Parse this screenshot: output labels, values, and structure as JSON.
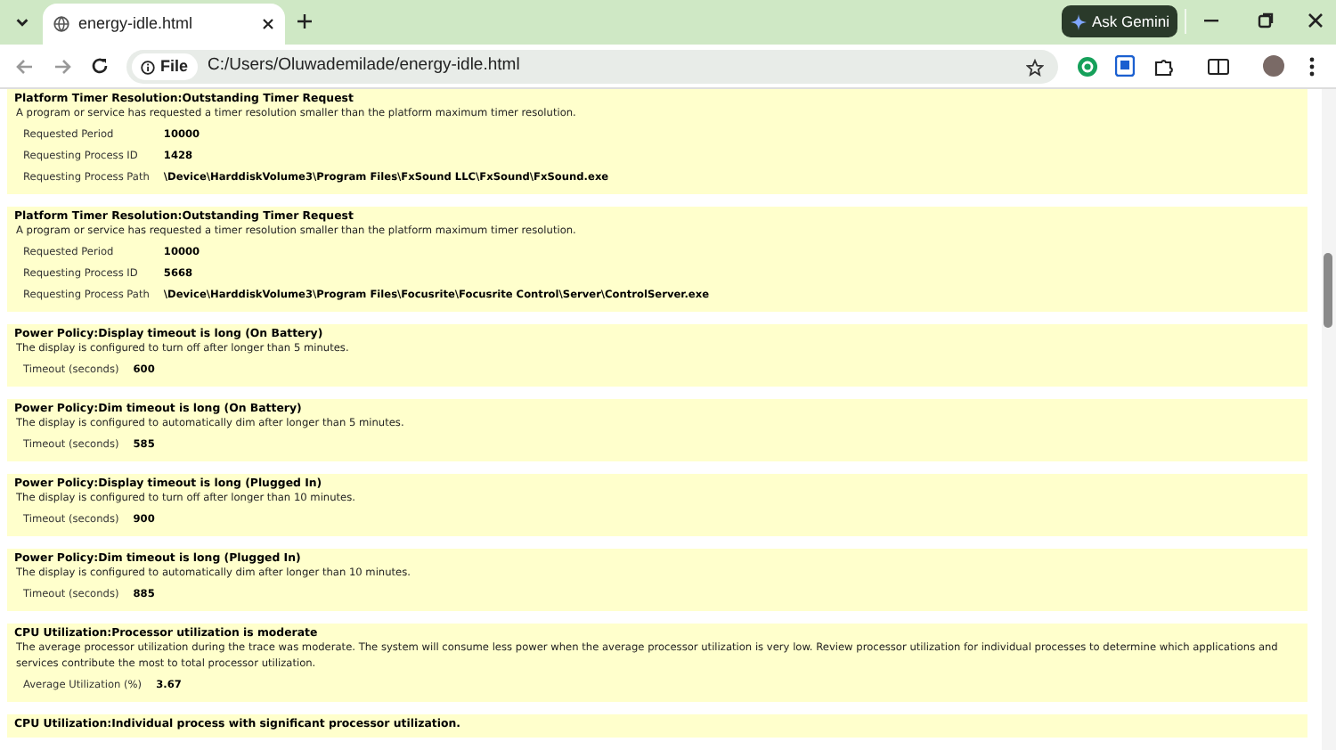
{
  "browser": {
    "tab": {
      "title": "energy-idle.html",
      "selected": true
    },
    "ask_button": "Ask Gemini",
    "address": {
      "scheme_chip": "File",
      "url": "C:/Users/Oluwademilade/energy-idle.html"
    }
  },
  "sections": [
    {
      "title": "Platform Timer Resolution:Outstanding Timer Request",
      "description": "A program or service has requested a timer resolution smaller than the platform maximum timer resolution.",
      "rows": [
        {
          "label": "Requested Period",
          "value": "10000"
        },
        {
          "label": "Requesting Process ID",
          "value": "1428"
        },
        {
          "label": "Requesting Process Path",
          "value": "\\Device\\HarddiskVolume3\\Program Files\\FxSound LLC\\FxSound\\FxSound.exe"
        }
      ]
    },
    {
      "title": "Platform Timer Resolution:Outstanding Timer Request",
      "description": "A program or service has requested a timer resolution smaller than the platform maximum timer resolution.",
      "rows": [
        {
          "label": "Requested Period",
          "value": "10000"
        },
        {
          "label": "Requesting Process ID",
          "value": "5668"
        },
        {
          "label": "Requesting Process Path",
          "value": "\\Device\\HarddiskVolume3\\Program Files\\Focusrite\\Focusrite Control\\Server\\ControlServer.exe"
        }
      ]
    },
    {
      "title": "Power Policy:Display timeout is long (On Battery)",
      "description": "The display is configured to turn off after longer than 5 minutes.",
      "rows": [
        {
          "label": "Timeout (seconds)",
          "value": "600"
        }
      ]
    },
    {
      "title": "Power Policy:Dim timeout is long (On Battery)",
      "description": "The display is configured to automatically dim after longer than 5 minutes.",
      "rows": [
        {
          "label": "Timeout (seconds)",
          "value": "585"
        }
      ]
    },
    {
      "title": "Power Policy:Display timeout is long (Plugged In)",
      "description": "The display is configured to turn off after longer than 10 minutes.",
      "rows": [
        {
          "label": "Timeout (seconds)",
          "value": "900"
        }
      ]
    },
    {
      "title": "Power Policy:Dim timeout is long (Plugged In)",
      "description": "The display is configured to automatically dim after longer than 10 minutes.",
      "rows": [
        {
          "label": "Timeout (seconds)",
          "value": "885"
        }
      ]
    },
    {
      "title": "CPU Utilization:Processor utilization is moderate",
      "description": "The average processor utilization during the trace was moderate. The system will consume less power when the average processor utilization is very low. Review processor utilization for individual processes to determine which applications and services contribute the most to total processor utilization.",
      "rows": [
        {
          "label": "Average Utilization (%)",
          "value": "3.67"
        }
      ]
    },
    {
      "title": "CPU Utilization:Individual process with significant processor utilization."
    }
  ]
}
